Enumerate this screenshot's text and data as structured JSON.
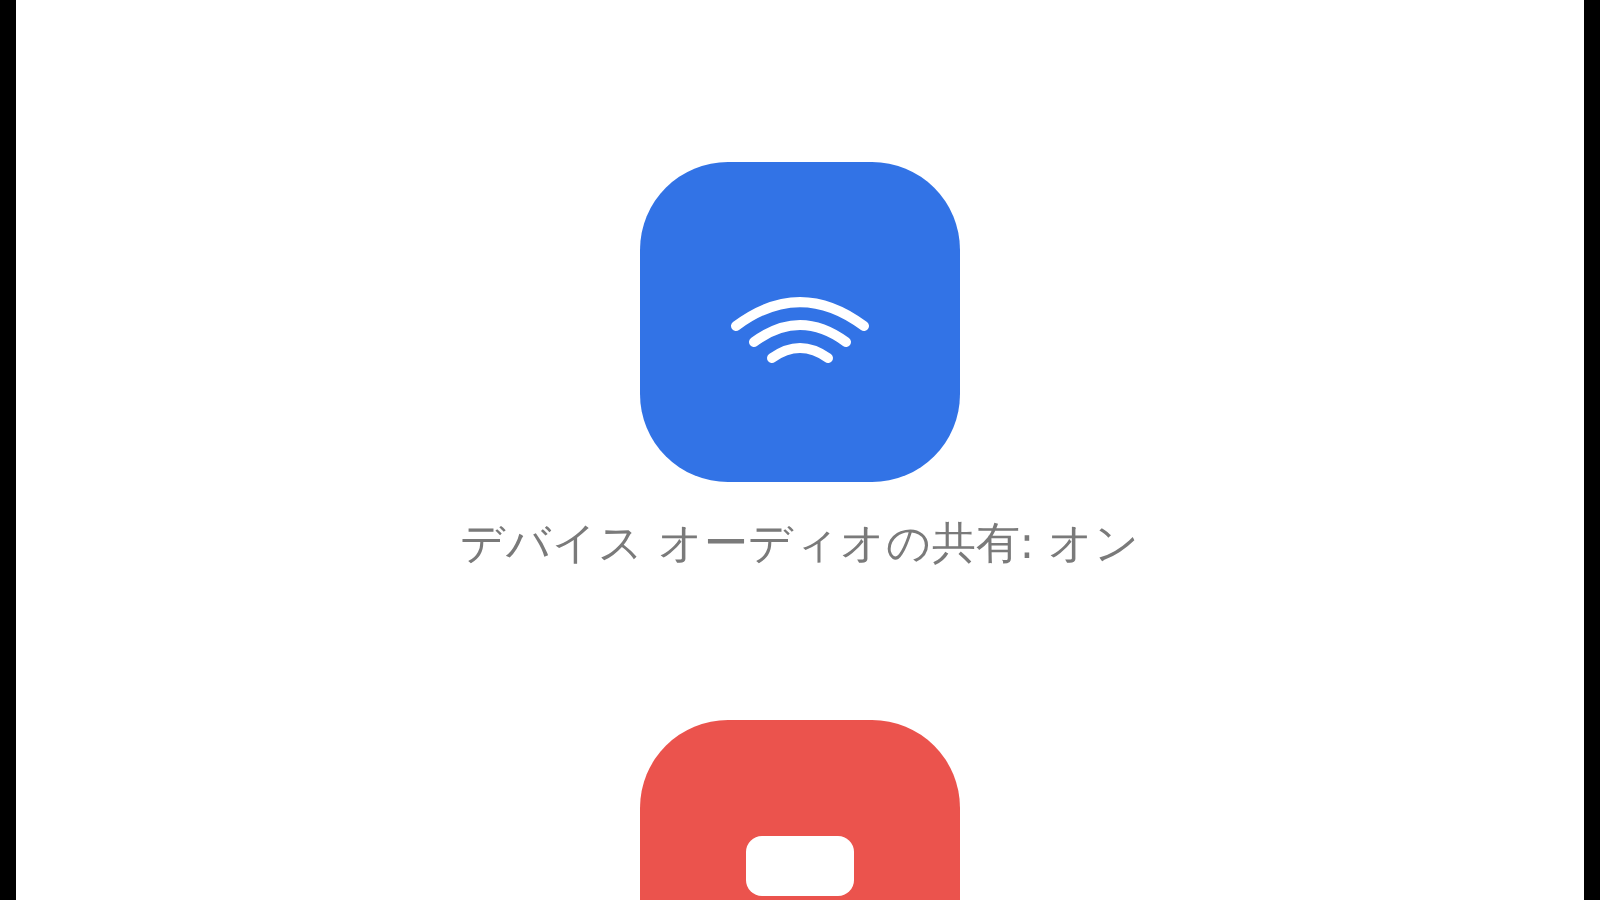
{
  "tiles": [
    {
      "kind": "audio",
      "color": "#3273e6",
      "label": "デバイス オーディオの共有: オン"
    },
    {
      "kind": "screen",
      "color": "#eb534d"
    }
  ]
}
